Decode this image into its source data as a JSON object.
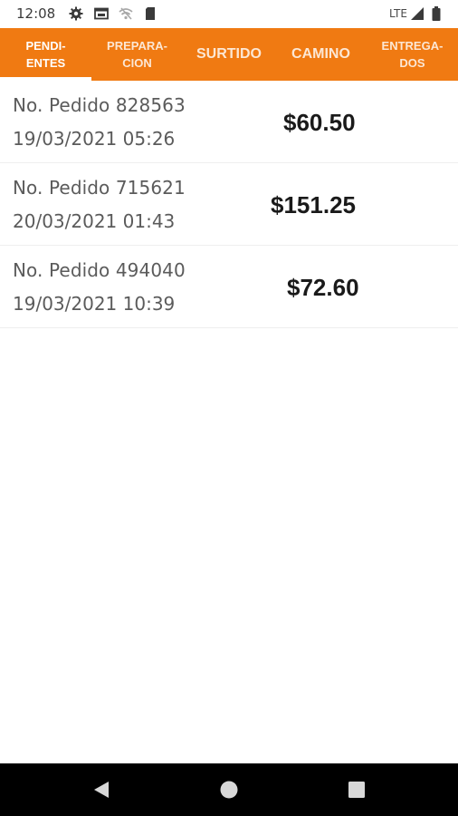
{
  "status_bar": {
    "time": "12:08",
    "network_label": "LTE",
    "icons": [
      "gear-icon",
      "screen-cast-icon",
      "wifi-off-icon",
      "sim-card-icon",
      "signal-icon",
      "battery-icon"
    ]
  },
  "tabs": [
    {
      "label": "PENDI-\nENTES",
      "active": true
    },
    {
      "label": "PREPARA-\nCION",
      "active": false
    },
    {
      "label": "SURTIDO",
      "active": false
    },
    {
      "label": "CAMINO",
      "active": false
    },
    {
      "label": "ENTREGA-\nDOS",
      "active": false
    }
  ],
  "orders": [
    {
      "number": "No. Pedido 828563",
      "date": "19/03/2021 05:26",
      "total": "$60.50"
    },
    {
      "number": "No. Pedido 715621",
      "date": "20/03/2021 01:43",
      "total": "$151.25"
    },
    {
      "number": "No. Pedido 494040",
      "date": "19/03/2021 10:39",
      "total": "$72.60"
    }
  ],
  "navigation": {
    "icons": [
      "back-icon",
      "home-icon",
      "recents-icon"
    ]
  },
  "colors": {
    "accent": "#f07a12",
    "text_secondary": "#5b5b5b",
    "text_primary": "#1a1a1a",
    "nav_background": "#000000"
  }
}
